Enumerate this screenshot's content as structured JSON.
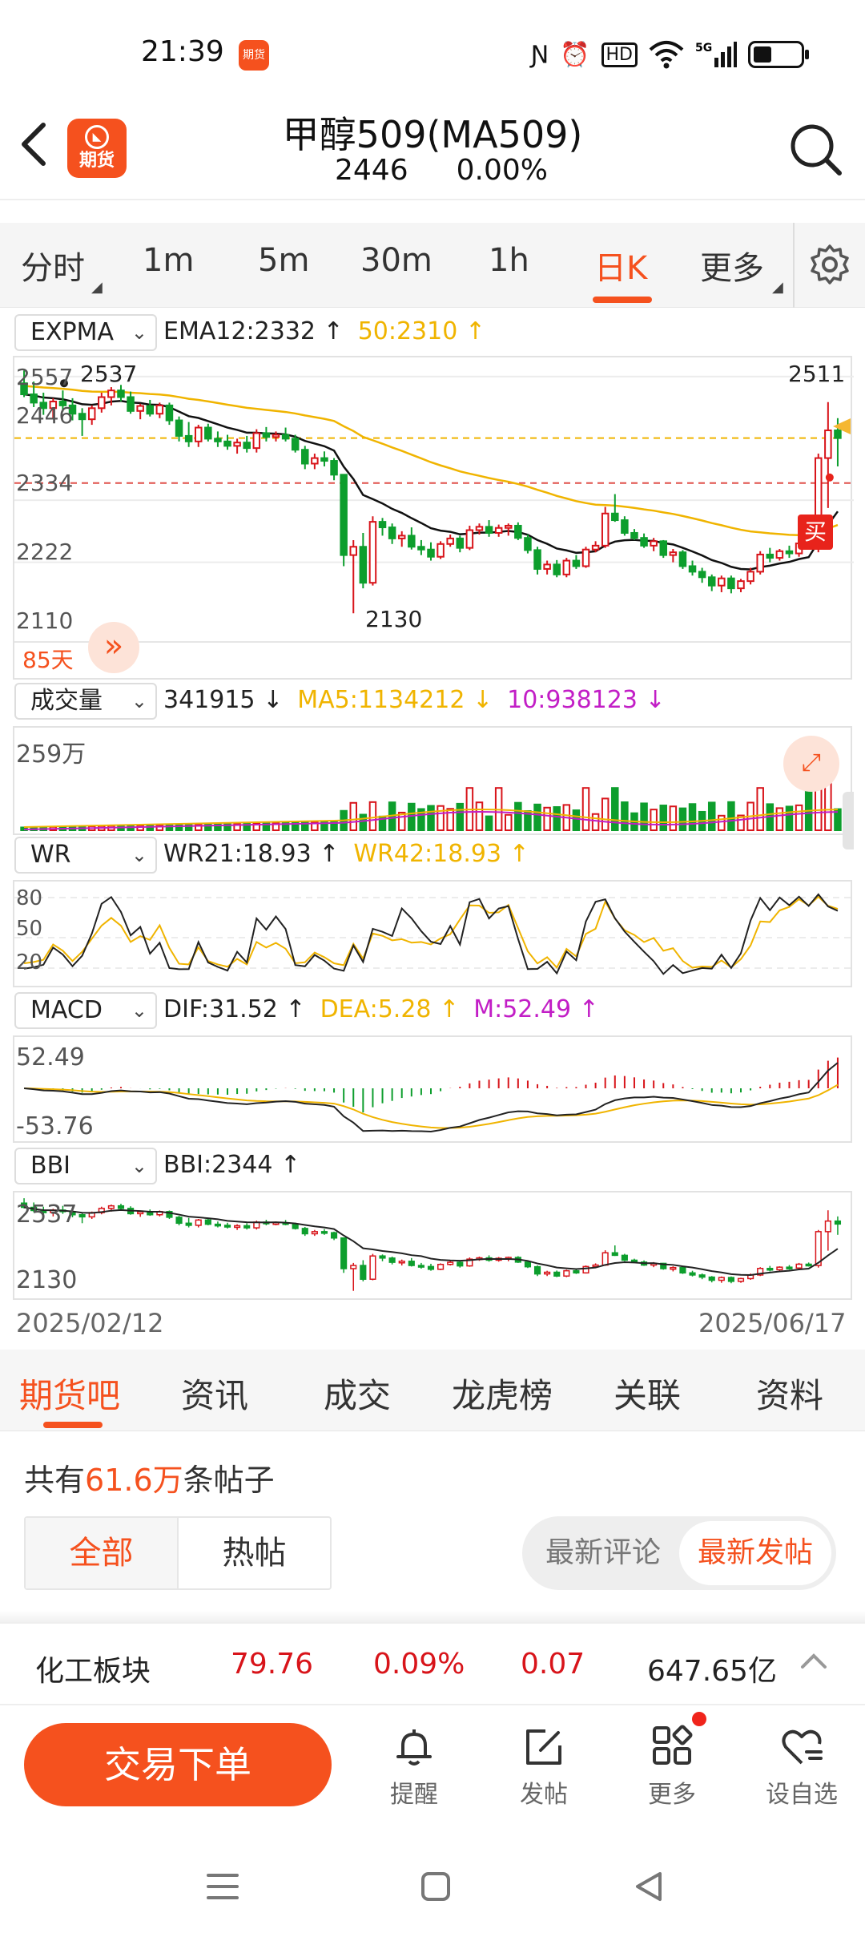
{
  "status": {
    "time": "21:39",
    "app_icon_text": "期货"
  },
  "header": {
    "title": "甲醇509(MA509)",
    "price": "2446",
    "change": "0.00%",
    "logo_text": "期货"
  },
  "periods": [
    "分时",
    "1m",
    "5m",
    "30m",
    "1h",
    "日K",
    "更多"
  ],
  "active_period": "日K",
  "kline": {
    "indicator": "EXPMA",
    "ema12": "EMA12:2332",
    "ema50": "50:2310",
    "y_ticks": [
      "2557",
      "2446",
      "2334",
      "2222",
      "2110"
    ],
    "high_label": "2537",
    "high_label_right": "2511",
    "low_label": "2130",
    "days_label": "85天",
    "buy_label": "买",
    "candles": [
      {
        "o": 2545,
        "h": 2568,
        "l": 2520,
        "c": 2525
      },
      {
        "o": 2525,
        "h": 2548,
        "l": 2502,
        "c": 2510
      },
      {
        "o": 2510,
        "h": 2528,
        "l": 2488,
        "c": 2500
      },
      {
        "o": 2500,
        "h": 2518,
        "l": 2482,
        "c": 2512
      },
      {
        "o": 2512,
        "h": 2532,
        "l": 2494,
        "c": 2505
      },
      {
        "o": 2505,
        "h": 2518,
        "l": 2478,
        "c": 2490
      },
      {
        "o": 2490,
        "h": 2500,
        "l": 2450,
        "c": 2480
      },
      {
        "o": 2480,
        "h": 2505,
        "l": 2470,
        "c": 2500
      },
      {
        "o": 2500,
        "h": 2528,
        "l": 2492,
        "c": 2520
      },
      {
        "o": 2520,
        "h": 2538,
        "l": 2505,
        "c": 2532
      },
      {
        "o": 2532,
        "h": 2542,
        "l": 2512,
        "c": 2520
      },
      {
        "o": 2520,
        "h": 2530,
        "l": 2490,
        "c": 2495
      },
      {
        "o": 2495,
        "h": 2508,
        "l": 2480,
        "c": 2504
      },
      {
        "o": 2504,
        "h": 2515,
        "l": 2485,
        "c": 2490
      },
      {
        "o": 2490,
        "h": 2510,
        "l": 2482,
        "c": 2505
      },
      {
        "o": 2505,
        "h": 2510,
        "l": 2470,
        "c": 2478
      },
      {
        "o": 2478,
        "h": 2485,
        "l": 2440,
        "c": 2450
      },
      {
        "o": 2450,
        "h": 2475,
        "l": 2430,
        "c": 2440
      },
      {
        "o": 2440,
        "h": 2470,
        "l": 2430,
        "c": 2465
      },
      {
        "o": 2465,
        "h": 2472,
        "l": 2440,
        "c": 2445
      },
      {
        "o": 2445,
        "h": 2458,
        "l": 2430,
        "c": 2440
      },
      {
        "o": 2440,
        "h": 2452,
        "l": 2425,
        "c": 2432
      },
      {
        "o": 2432,
        "h": 2445,
        "l": 2418,
        "c": 2438
      },
      {
        "o": 2438,
        "h": 2450,
        "l": 2420,
        "c": 2428
      },
      {
        "o": 2428,
        "h": 2462,
        "l": 2420,
        "c": 2455
      },
      {
        "o": 2455,
        "h": 2466,
        "l": 2440,
        "c": 2448
      },
      {
        "o": 2448,
        "h": 2458,
        "l": 2440,
        "c": 2452
      },
      {
        "o": 2452,
        "h": 2465,
        "l": 2440,
        "c": 2445
      },
      {
        "o": 2445,
        "h": 2452,
        "l": 2420,
        "c": 2425
      },
      {
        "o": 2425,
        "h": 2432,
        "l": 2390,
        "c": 2400
      },
      {
        "o": 2400,
        "h": 2418,
        "l": 2390,
        "c": 2410
      },
      {
        "o": 2410,
        "h": 2422,
        "l": 2395,
        "c": 2405
      },
      {
        "o": 2405,
        "h": 2410,
        "l": 2370,
        "c": 2380
      },
      {
        "o": 2380,
        "h": 2300,
        "l": 2215,
        "c": 2235
      },
      {
        "o": 2235,
        "h": 2262,
        "l": 2130,
        "c": 2250
      },
      {
        "o": 2250,
        "h": 2275,
        "l": 2175,
        "c": 2185
      },
      {
        "o": 2185,
        "h": 2305,
        "l": 2180,
        "c": 2295
      },
      {
        "o": 2295,
        "h": 2302,
        "l": 2270,
        "c": 2285
      },
      {
        "o": 2285,
        "h": 2292,
        "l": 2255,
        "c": 2265
      },
      {
        "o": 2265,
        "h": 2278,
        "l": 2250,
        "c": 2270
      },
      {
        "o": 2270,
        "h": 2285,
        "l": 2245,
        "c": 2250
      },
      {
        "o": 2250,
        "h": 2262,
        "l": 2235,
        "c": 2245
      },
      {
        "o": 2245,
        "h": 2258,
        "l": 2225,
        "c": 2232
      },
      {
        "o": 2232,
        "h": 2260,
        "l": 2228,
        "c": 2255
      },
      {
        "o": 2255,
        "h": 2272,
        "l": 2250,
        "c": 2265
      },
      {
        "o": 2265,
        "h": 2270,
        "l": 2240,
        "c": 2248
      },
      {
        "o": 2248,
        "h": 2288,
        "l": 2244,
        "c": 2280
      },
      {
        "o": 2280,
        "h": 2292,
        "l": 2272,
        "c": 2286
      },
      {
        "o": 2286,
        "h": 2298,
        "l": 2268,
        "c": 2275
      },
      {
        "o": 2275,
        "h": 2290,
        "l": 2268,
        "c": 2284
      },
      {
        "o": 2284,
        "h": 2292,
        "l": 2270,
        "c": 2288
      },
      {
        "o": 2288,
        "h": 2294,
        "l": 2262,
        "c": 2266
      },
      {
        "o": 2266,
        "h": 2272,
        "l": 2238,
        "c": 2244
      },
      {
        "o": 2244,
        "h": 2250,
        "l": 2200,
        "c": 2210
      },
      {
        "o": 2210,
        "h": 2225,
        "l": 2200,
        "c": 2218
      },
      {
        "o": 2218,
        "h": 2226,
        "l": 2195,
        "c": 2200
      },
      {
        "o": 2200,
        "h": 2230,
        "l": 2195,
        "c": 2225
      },
      {
        "o": 2225,
        "h": 2235,
        "l": 2210,
        "c": 2215
      },
      {
        "o": 2215,
        "h": 2250,
        "l": 2212,
        "c": 2245
      },
      {
        "o": 2245,
        "h": 2260,
        "l": 2240,
        "c": 2252
      },
      {
        "o": 2252,
        "h": 2322,
        "l": 2248,
        "c": 2310
      },
      {
        "o": 2310,
        "h": 2345,
        "l": 2295,
        "c": 2298
      },
      {
        "o": 2298,
        "h": 2305,
        "l": 2270,
        "c": 2275
      },
      {
        "o": 2275,
        "h": 2282,
        "l": 2262,
        "c": 2266
      },
      {
        "o": 2266,
        "h": 2274,
        "l": 2248,
        "c": 2252
      },
      {
        "o": 2252,
        "h": 2266,
        "l": 2242,
        "c": 2260
      },
      {
        "o": 2260,
        "h": 2262,
        "l": 2230,
        "c": 2235
      },
      {
        "o": 2235,
        "h": 2246,
        "l": 2222,
        "c": 2240
      },
      {
        "o": 2240,
        "h": 2244,
        "l": 2210,
        "c": 2215
      },
      {
        "o": 2215,
        "h": 2225,
        "l": 2198,
        "c": 2205
      },
      {
        "o": 2205,
        "h": 2212,
        "l": 2185,
        "c": 2195
      },
      {
        "o": 2195,
        "h": 2200,
        "l": 2170,
        "c": 2180
      },
      {
        "o": 2180,
        "h": 2198,
        "l": 2168,
        "c": 2193
      },
      {
        "o": 2193,
        "h": 2198,
        "l": 2166,
        "c": 2175
      },
      {
        "o": 2175,
        "h": 2192,
        "l": 2168,
        "c": 2188
      },
      {
        "o": 2188,
        "h": 2212,
        "l": 2182,
        "c": 2205
      },
      {
        "o": 2205,
        "h": 2242,
        "l": 2200,
        "c": 2236
      },
      {
        "o": 2236,
        "h": 2248,
        "l": 2222,
        "c": 2230
      },
      {
        "o": 2230,
        "h": 2246,
        "l": 2225,
        "c": 2242
      },
      {
        "o": 2242,
        "h": 2252,
        "l": 2230,
        "c": 2238
      },
      {
        "o": 2238,
        "h": 2262,
        "l": 2232,
        "c": 2256
      },
      {
        "o": 2256,
        "h": 2264,
        "l": 2245,
        "c": 2250
      },
      {
        "o": 2250,
        "h": 2418,
        "l": 2240,
        "c": 2410
      },
      {
        "o": 2410,
        "h": 2511,
        "l": 2320,
        "c": 2460
      },
      {
        "o": 2460,
        "h": 2482,
        "l": 2395,
        "c": 2446
      }
    ]
  },
  "volume": {
    "indicator": "成交量",
    "value": "341915",
    "ma5": "MA5:1134212",
    "ma10": "10:938123",
    "y_label": "259万"
  },
  "wr": {
    "indicator": "WR",
    "wr21": "WR21:18.93",
    "wr42": "WR42:18.93",
    "y_ticks": [
      "80",
      "50",
      "20"
    ]
  },
  "macd": {
    "indicator": "MACD",
    "dif": "DIF:31.52",
    "dea": "DEA:5.28",
    "m": "M:52.49",
    "y_top": "52.49",
    "y_bottom": "-53.76"
  },
  "bbi": {
    "indicator": "BBI",
    "value": "BBI:2344",
    "y_top": "2537",
    "y_bottom": "2130"
  },
  "dates": {
    "start": "2025/02/12",
    "end": "2025/06/17"
  },
  "tabs": [
    "期货吧",
    "资讯",
    "成交",
    "龙虎榜",
    "关联",
    "资料"
  ],
  "posts": {
    "prefix": "共有",
    "count": "61.6万",
    "suffix": "条帖子"
  },
  "filters": [
    "全部",
    "热帖"
  ],
  "sort": [
    "最新评论",
    "最新发帖"
  ],
  "sector": {
    "name": "化工板块",
    "price": "79.76",
    "pct": "0.09%",
    "chg": "0.07",
    "amount": "647.65亿"
  },
  "bottom": {
    "trade": "交易下单",
    "nav": [
      "提醒",
      "发帖",
      "更多",
      "设自选"
    ]
  },
  "colors": {
    "accent": "#f5511e",
    "up": "#d8141a",
    "down": "#0d9e2d",
    "ema50": "#f0b400",
    "macd_m": "#c21ec6"
  }
}
